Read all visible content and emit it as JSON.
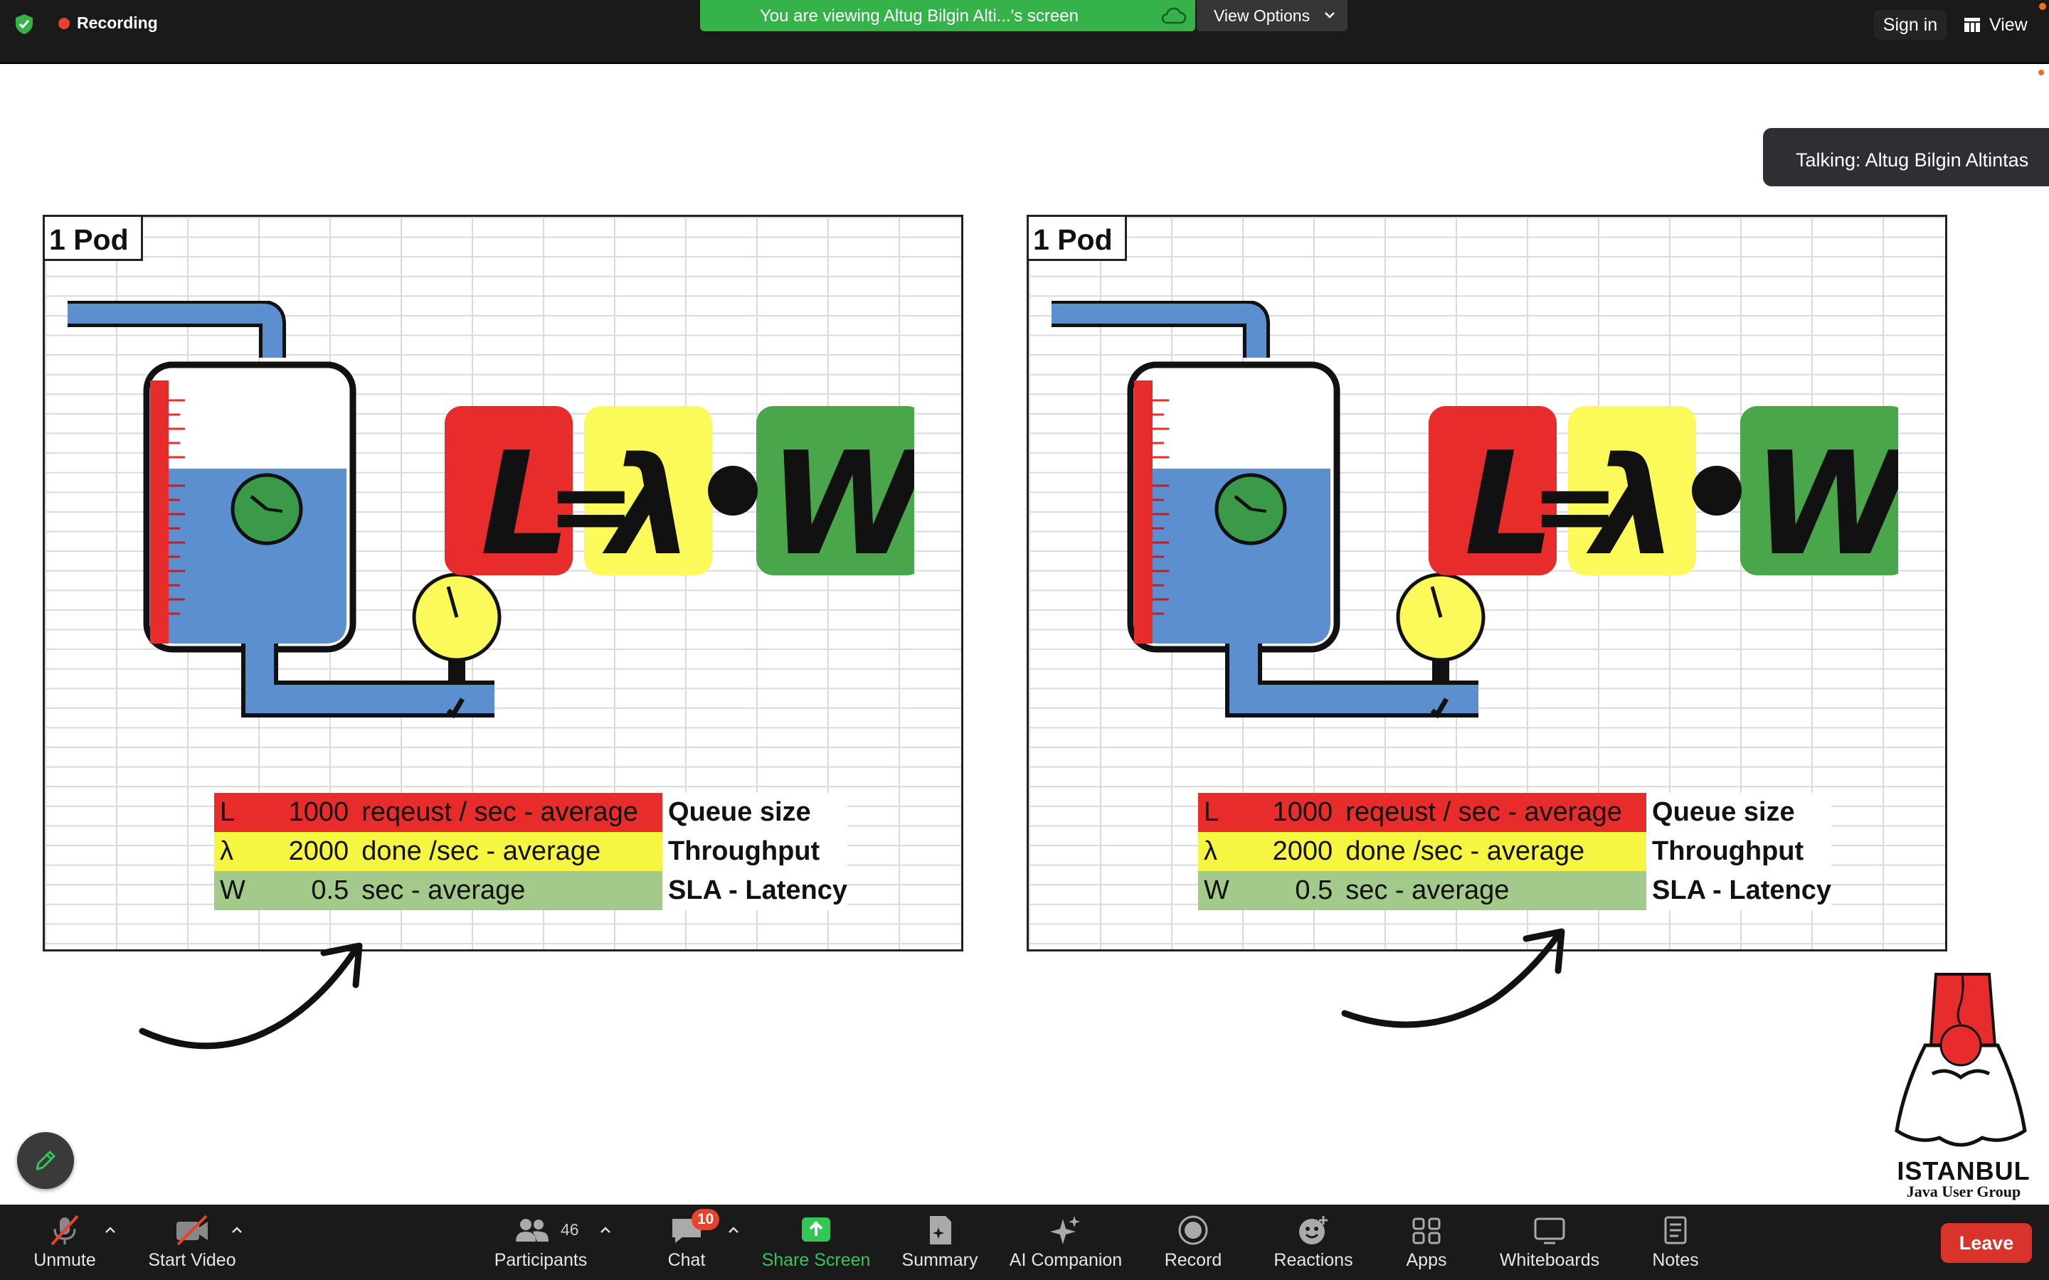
{
  "window": {
    "recording_label": "Recording",
    "viewing_banner": "You are viewing Altug Bilgin Alti...'s screen",
    "view_options_label": "View Options",
    "sign_in_label": "Sign in",
    "view_label": "View"
  },
  "talking_tooltip": "Talking: Altug Bilgin Altintas",
  "slides": [
    {
      "pod_label": "1 Pod",
      "formula": {
        "l": "L",
        "eq": "=",
        "lambda": "λ",
        "w": "W"
      },
      "rows": [
        {
          "sym": "L",
          "val": "1000",
          "unit": "reqeust / sec - average",
          "label": "Queue size"
        },
        {
          "sym": "λ",
          "val": "2000",
          "unit": "done /sec - average",
          "label": "Throughput"
        },
        {
          "sym": "W",
          "val": "0.5",
          "unit": "sec  - average",
          "label": "SLA - Latency"
        }
      ]
    },
    {
      "pod_label": "1 Pod",
      "formula": {
        "l": "L",
        "eq": "=",
        "lambda": "λ",
        "w": "W"
      },
      "rows": [
        {
          "sym": "L",
          "val": "1000",
          "unit": "reqeust / sec - average",
          "label": "Queue size"
        },
        {
          "sym": "λ",
          "val": "2000",
          "unit": "done /sec - average",
          "label": "Throughput"
        },
        {
          "sym": "W",
          "val": "0.5",
          "unit": "sec  - average",
          "label": "SLA - Latency"
        }
      ]
    }
  ],
  "logo": {
    "title": "ISTANBUL",
    "subtitle": "Java User Group"
  },
  "toolbar": {
    "unmute": "Unmute",
    "start_video": "Start Video",
    "participants": "Participants",
    "participants_count": "46",
    "chat": "Chat",
    "chat_badge": "10",
    "share_screen": "Share Screen",
    "summary": "Summary",
    "ai_companion": "AI Companion",
    "record": "Record",
    "reactions": "Reactions",
    "apps": "Apps",
    "whiteboards": "Whiteboards",
    "notes": "Notes",
    "leave": "Leave"
  },
  "colors": {
    "accent_green": "#35b34a",
    "leave_red": "#d9342b",
    "formula_red": "#e82b2b",
    "formula_yellow": "#fbfa5a",
    "formula_green": "#4aa64a",
    "tank_blue": "#5b8fcf"
  }
}
